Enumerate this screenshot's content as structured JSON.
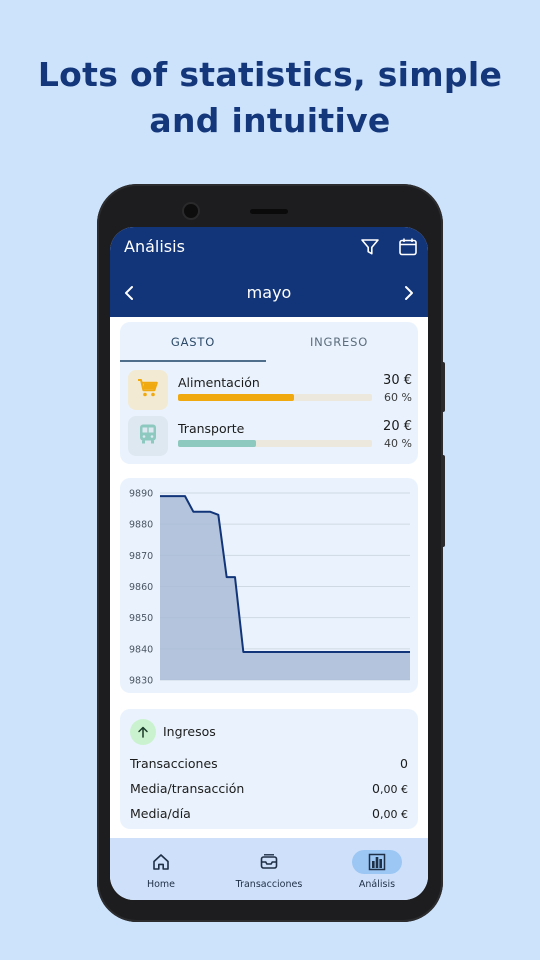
{
  "headline": {
    "line1": "Lots of statistics, simple",
    "line2": "and intuitive"
  },
  "appbar": {
    "title": "Análisis",
    "month": "mayo"
  },
  "tabs": [
    {
      "label": "GASTO",
      "active": true
    },
    {
      "label": "INGRESO",
      "active": false
    }
  ],
  "categories": [
    {
      "name": "Alimentación",
      "amount": "30 €",
      "percent": "60 %",
      "fraction": 0.6,
      "color": "#f0a90e",
      "badge_bg": "#f3ead4",
      "icon": "cart-icon"
    },
    {
      "name": "Transporte",
      "amount": "20 €",
      "percent": "40 %",
      "fraction": 0.4,
      "color": "#8ec9c0",
      "badge_bg": "#dde8f1",
      "icon": "bus-icon"
    }
  ],
  "chart_data": {
    "type": "area",
    "x": [
      1,
      2,
      3,
      4,
      5,
      6,
      7,
      8,
      9,
      10,
      11,
      12,
      13,
      14,
      15,
      16,
      17,
      18,
      19,
      20,
      21,
      22,
      23,
      24,
      25,
      26,
      27,
      28,
      29,
      30,
      31
    ],
    "values": [
      9889,
      9889,
      9889,
      9889,
      9884,
      9884,
      9884,
      9883,
      9863,
      9863,
      9839,
      9839,
      9839,
      9839,
      9839,
      9839,
      9839,
      9839,
      9839,
      9839,
      9839,
      9839,
      9839,
      9839,
      9839,
      9839,
      9839,
      9839,
      9839,
      9839,
      9839
    ],
    "yticks": [
      "9890",
      "9880",
      "9870",
      "9860",
      "9850",
      "9840",
      "9830"
    ],
    "ylim": [
      9830,
      9890
    ],
    "grid": true,
    "line_color": "#12357a",
    "fill_color": "#a9bbd6"
  },
  "stats": {
    "heading": "Ingresos",
    "rows": [
      {
        "label": "Transacciones",
        "value_main": "0",
        "value_dec": ""
      },
      {
        "label": "Media/transacción",
        "value_main": "0",
        "value_dec": ",00 €"
      },
      {
        "label": "Media/día",
        "value_main": "0",
        "value_dec": ",00 €"
      }
    ]
  },
  "nav": [
    {
      "label": "Home",
      "icon": "home-icon",
      "selected": false
    },
    {
      "label": "Transacciones",
      "icon": "inbox-icon",
      "selected": false
    },
    {
      "label": "Análisis",
      "icon": "bar-chart-icon",
      "selected": true
    }
  ]
}
